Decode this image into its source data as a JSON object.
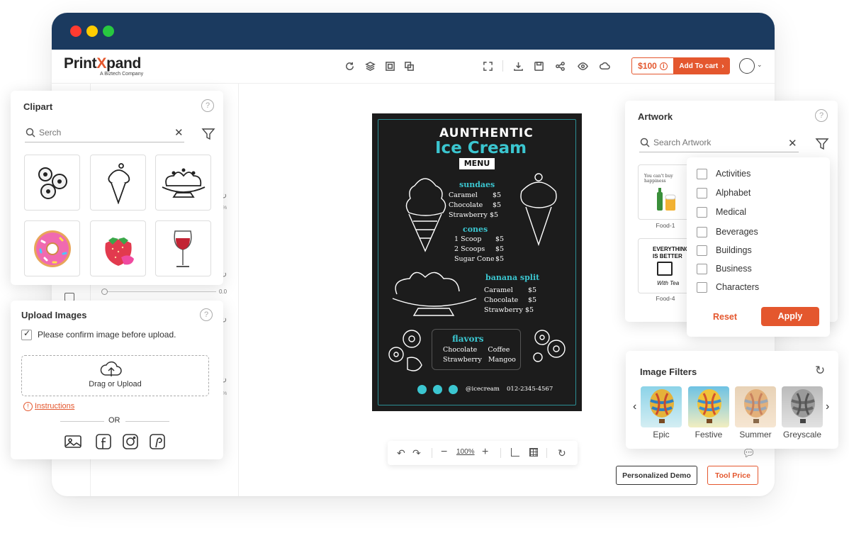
{
  "brand": {
    "logo_a": "Print",
    "logo_x": "X",
    "logo_b": "pand",
    "tagline": "A Biztech Company"
  },
  "toolbar": {
    "price": "$100",
    "cart_label": "Add To cart"
  },
  "poster": {
    "title_line1": "AUNTHENTIC",
    "title_line2": "Ice Cream",
    "menu": "MENU",
    "sundaes_heading": "sundaes",
    "sundaes": [
      {
        "name": "Caramel",
        "price": "$5"
      },
      {
        "name": "Chocolate",
        "price": "$5"
      },
      {
        "name": "Strawberry",
        "price": "$5"
      }
    ],
    "cones_heading": "cones",
    "cones": [
      {
        "name": "1 Scoop",
        "price": "$5"
      },
      {
        "name": "2 Scoops",
        "price": "$5"
      },
      {
        "name": "Sugar Cone",
        "price": "$5"
      }
    ],
    "banana_heading": "banana split",
    "banana": [
      {
        "name": "Caramel",
        "price": "$5"
      },
      {
        "name": "Chocolate",
        "price": "$5"
      },
      {
        "name": "Strawberry",
        "price": "$5"
      }
    ],
    "flavors_heading": "flavors",
    "flavors_row1": "Chocolate     Coffee",
    "flavors_row2": "Strawberry   Mangoo",
    "handle": "@icecream",
    "phone": "012-2345-4567"
  },
  "zoom": {
    "level": "100%"
  },
  "buttons": {
    "demo": "Personalized Demo",
    "tool_price": "Tool Price"
  },
  "side_panel": {
    "slider_value": "0.0",
    "pct_a": "%",
    "pct_b": "%"
  },
  "clipart": {
    "title": "Clipart",
    "help": "?",
    "search_placeholder": "Serch",
    "items": [
      "donuts-clipart",
      "ice-cream-cone-clipart",
      "sundae-clipart",
      "pink-donut-clipart",
      "strawberry-clipart",
      "wine-glass-clipart"
    ]
  },
  "upload": {
    "title": "Upload Images",
    "help": "?",
    "confirm_label": "Please confirm image before upload.",
    "drop_label": "Drag or Upload",
    "instructions": "Instructions",
    "or": "OR"
  },
  "artwork": {
    "title": "Artwork",
    "help": "?",
    "search_placeholder": "Search Artwork",
    "tiles": [
      {
        "caption": "Food-1",
        "text": "You can't buy happiness"
      },
      {
        "caption": "Food-4",
        "line1": "EVERYTHING",
        "line2": "IS BETTER",
        "line3": "With Tea"
      }
    ],
    "filter_categories": [
      "Activities",
      "Alphabet",
      "Medical",
      "Beverages",
      "Buildings",
      "Business",
      "Characters"
    ],
    "reset_label": "Reset",
    "apply_label": "Apply"
  },
  "image_filters": {
    "title": "Image Filters",
    "items": [
      {
        "label": "Epic"
      },
      {
        "label": "Festive"
      },
      {
        "label": "Summer"
      },
      {
        "label": "Greyscale"
      }
    ]
  },
  "colors": {
    "accent": "#e4572e",
    "titlebar": "#1b3a5f",
    "teal": "#3bc6d0"
  }
}
